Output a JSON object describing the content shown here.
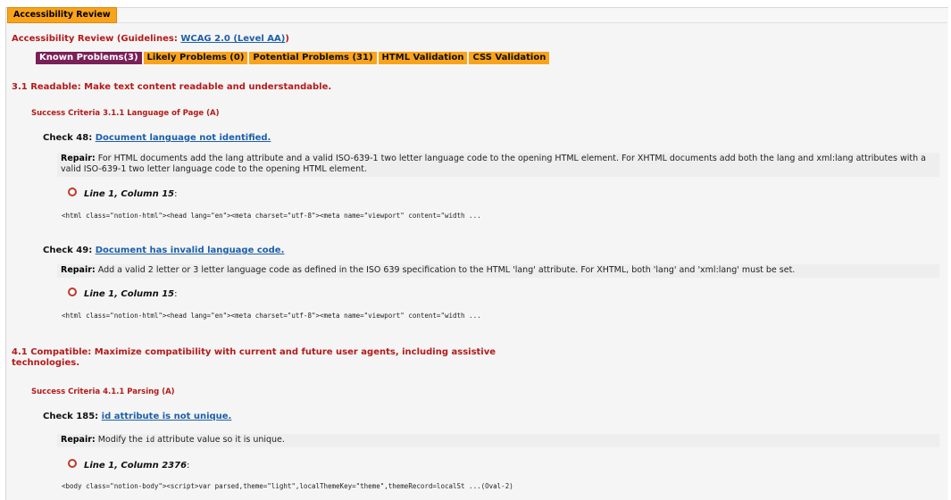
{
  "legend": "Accessibility Review",
  "review": {
    "prefix": "Accessibility Review (Guidelines: ",
    "link": "WCAG 2.0 (Level AA)",
    "suffix": ")"
  },
  "tabs": [
    {
      "label": "Known Problems(3)",
      "active": true
    },
    {
      "label": "Likely Problems (0)",
      "active": false
    },
    {
      "label": "Potential Problems (31)",
      "active": false
    },
    {
      "label": "HTML Validation",
      "active": false
    },
    {
      "label": "CSS Validation",
      "active": false
    }
  ],
  "guideline1": "3.1 Readable: Make text content readable and understandable.",
  "criteria1": "Success Criteria 3.1.1 Language of Page (A)",
  "check48": {
    "prefix": "Check 48: ",
    "link": "Document language not identified.",
    "repair_label": "Repair:",
    "repair_text": " For HTML documents add the lang attribute and a valid ISO-639-1 two letter language code to the opening HTML element. For XHTML documents add both the lang and xml:lang attributes with a valid ISO-639-1 two letter language code to the opening HTML element.",
    "location": "Line 1, Column 15",
    "location_suffix": ":",
    "code": "<html class=\"notion-html\"><head lang=\"en\"><meta charset=\"utf-8\"><meta name=\"viewport\" content=\"width ..."
  },
  "check49": {
    "prefix": "Check 49: ",
    "link": "Document has invalid language code.",
    "repair_label": "Repair:",
    "repair_text": " Add a valid 2 letter or 3 letter language code as defined in the ISO 639 specification to the HTML 'lang' attribute. For XHTML, both 'lang' and 'xml:lang' must be set.",
    "location": "Line 1, Column 15",
    "location_suffix": ":",
    "code": "<html class=\"notion-html\"><head lang=\"en\"><meta charset=\"utf-8\"><meta name=\"viewport\" content=\"width ..."
  },
  "guideline2_line1": "4.1 Compatible: Maximize compatibility with current and future user agents, including assistive",
  "guideline2_line2": "technologies.",
  "criteria2": "Success Criteria 4.1.1 Parsing (A)",
  "check185": {
    "prefix": "Check 185: ",
    "link": "id attribute is not unique.",
    "repair_label": "Repair:",
    "repair_pre": " Modify the ",
    "repair_code": "id",
    "repair_post": " attribute value so it is unique.",
    "location": "Line 1, Column 2376",
    "location_suffix": ":",
    "code": "<body class=\"notion-body\"><script>var parsed,theme=\"light\",localThemeKey=\"theme\",themeRecord=localSt ...(Oval-2)"
  }
}
